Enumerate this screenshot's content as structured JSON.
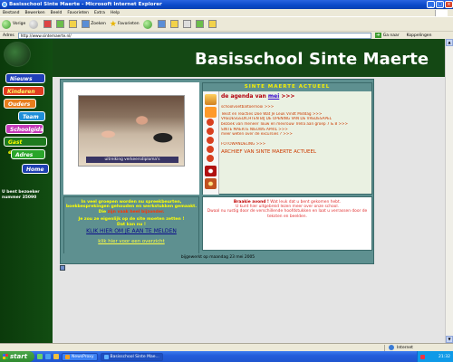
{
  "window": {
    "title": "Basisschool Sinte Maerte - Microsoft Internet Explorer"
  },
  "menu": [
    "Bestand",
    "Bewerken",
    "Beeld",
    "Favorieten",
    "Extra",
    "Help"
  ],
  "toolbar": {
    "back_label": "Vorige",
    "search_label": "Zoeken",
    "favorites_label": "Favorieten"
  },
  "address": {
    "label": "Adres",
    "value": "http://www.sintemaerte.nl/",
    "go_label": "Ga naar",
    "links_label": "Koppelingen"
  },
  "site": {
    "title": "Basisschool Sinte Maerte",
    "nav": [
      {
        "label": "Nieuws",
        "bg": "#1f3fb8",
        "color": "#ffffff"
      },
      {
        "label": "Kinderen",
        "bg": "#e03b1f",
        "color": "#ffff66"
      },
      {
        "label": "Ouders",
        "bg": "#e87e1d",
        "color": "#ffffff"
      },
      {
        "label": "Team",
        "bg": "#1f8fd8",
        "color": "#ffffff"
      },
      {
        "label": "Schoolgids",
        "bg": "#c43ab8",
        "color": "#ffffff"
      },
      {
        "label": "Gast enboek",
        "bg": "#1e7a1e",
        "color": "#ffff00"
      },
      {
        "label": "Adres",
        "bg": "#2aa52a",
        "color": "#ffffff"
      },
      {
        "label": "Home",
        "bg": "#1e3fb0",
        "color": "#ffffff"
      }
    ],
    "visitor": {
      "label": "U bent bezoeker",
      "number": "nummer 35090"
    },
    "photo_caption": "uitreiking verkeersdiploma's",
    "actueel": {
      "header": "SINTE MAERTE ACTUEEL",
      "agenda_prefix": "de agenda van ",
      "agenda_month": "mei",
      "agenda_suffix": " >>>",
      "items": [
        "schoolvoetbaltoernooi >>>",
        "Tekst en reacties Doe Wat Je Leuk Vindt Middag >>>",
        "VREDESGEDICHTEN BIJ DE OPENING VAN DE VREDESAPEL",
        "bezoek van meneer Touw en mevrouw Trella aan groep 7 & 8 >>>",
        "SINTE MAERTE NIEUWS APRIL >>>",
        "meer weten over de excursies ? >>>",
        "FOTOWANDELING >>>"
      ],
      "archive": "ARCHIEF VAN SINTE MAERTE ACTUEEL"
    },
    "left_info": {
      "line1": "In veel groepen worden nu spreekbeurten,",
      "line2": "boekbesprekingen gehouden en werkstukken gemaakt.",
      "line3_pre": "Die ",
      "line3_hl": "zijn vaak",
      "line3_post": " heel bijzonder.",
      "line4": "Je zou ze eigenlijk op de site moeten zetten !",
      "line5": "Dat kan nu !",
      "link1": "KLIK HIER OM JE AAN TE MELDEN",
      "link2": "klik hier voor een overzicht"
    },
    "right_info": {
      "bold": "Braakie avond !",
      "line1": " Wat leuk dat u bent gekomen hebt.",
      "line2": "U kunt hier uitgebreid lezen meer over onze school.",
      "line3": "Dwaal nu rustig door de verschillende hoofdstukken en laat u verrassen door de",
      "line4": "teksten en beelden."
    },
    "footer": "bijgewerkt op maandag 23 mei 2005"
  },
  "status": {
    "zone": "Internet"
  },
  "taskbar": {
    "start": "start",
    "tasks": [
      "NewsProxy",
      "Basisschool Sinte Mae..."
    ],
    "clock": "21:32"
  }
}
